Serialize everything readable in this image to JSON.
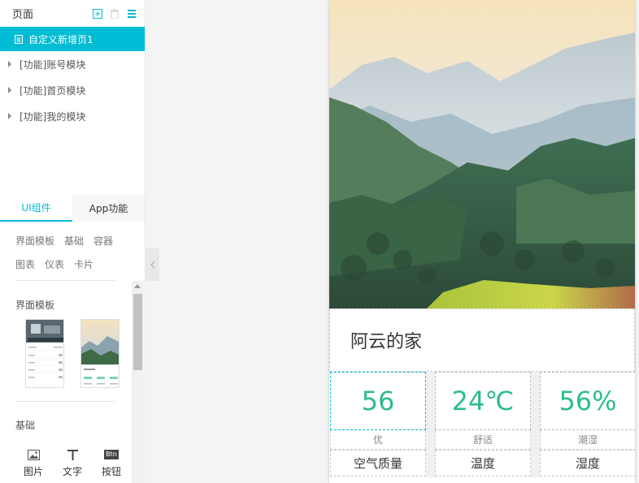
{
  "pages": {
    "title": "页面",
    "active_page": "自定义新增页1",
    "items": [
      "[功能]账号模块",
      "[功能]首页模块",
      "[功能]我的模块"
    ]
  },
  "tabs": [
    "UI组件",
    "App功能"
  ],
  "categories": [
    "界面模板",
    "基础",
    "容器",
    "图表",
    "仪表",
    "卡片"
  ],
  "sections": {
    "templates": "界面模板",
    "basic": "基础"
  },
  "components": [
    "图片",
    "文字",
    "按钮"
  ],
  "btn_icon_text": "Btn",
  "phone": {
    "home_name": "阿云的家",
    "stats": [
      {
        "value": "56",
        "sub": "优",
        "label": "空气质量"
      },
      {
        "value": "24℃",
        "sub": "舒适",
        "label": "温度"
      },
      {
        "value": "56%",
        "sub": "潮湿",
        "label": "湿度"
      }
    ]
  },
  "colors": {
    "accent": "#00bcd4",
    "stat_value": "#2dbd8a"
  }
}
